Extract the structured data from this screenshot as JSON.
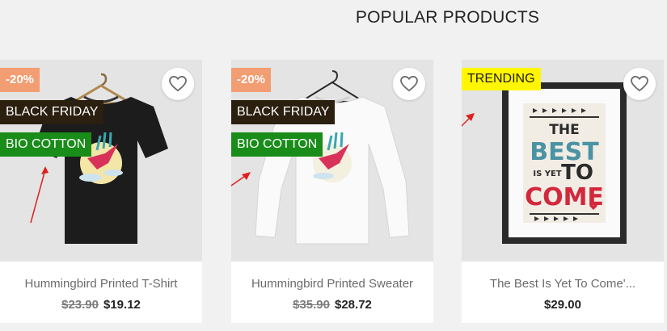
{
  "section": {
    "title": "POPULAR PRODUCTS"
  },
  "products": [
    {
      "name": "Hummingbird Printed T-Shirt",
      "old_price": "$23.90",
      "price": "$19.12",
      "discount": "-20%",
      "labels": [
        "BLACK FRIDAY",
        "BIO COTTON"
      ],
      "image": "black-tshirt-hummingbird"
    },
    {
      "name": "Hummingbird Printed Sweater",
      "old_price": "$35.90",
      "price": "$28.72",
      "discount": "-20%",
      "labels": [
        "BLACK FRIDAY",
        "BIO COTTON"
      ],
      "image": "white-sweater-hummingbird"
    },
    {
      "name": "The Best Is Yet To Come'...",
      "price": "$29.00",
      "labels": [
        "TRENDING"
      ],
      "image": "framed-poster"
    }
  ],
  "poster": {
    "line1": "THE",
    "line2": "BEST",
    "line3": "IS YET",
    "line4": "TO",
    "line5": "COME"
  },
  "colors": {
    "discount": "#f39d72",
    "black_friday": "#2b1f0f",
    "bio_cotton": "#1a8c1a",
    "trending": "#fff600",
    "annotation_arrow": "#e02020"
  },
  "icons": {
    "wishlist": "heart-outline-icon"
  }
}
